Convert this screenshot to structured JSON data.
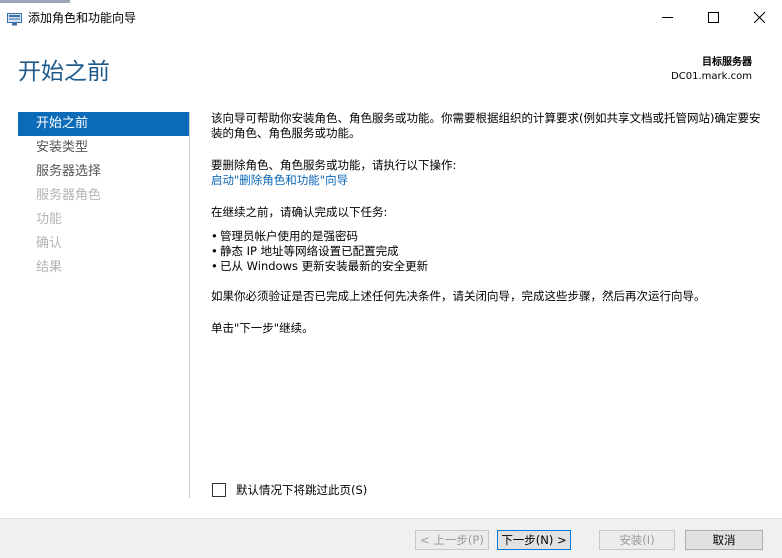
{
  "window": {
    "title": "添加角色和功能向导"
  },
  "header": {
    "page_title": "开始之前",
    "target_label": "目标服务器",
    "target_value": "DC01.mark.com"
  },
  "nav": {
    "items": [
      {
        "label": "开始之前",
        "state": "active"
      },
      {
        "label": "安装类型",
        "state": "normal"
      },
      {
        "label": "服务器选择",
        "state": "normal"
      },
      {
        "label": "服务器角色",
        "state": "disabled"
      },
      {
        "label": "功能",
        "state": "disabled"
      },
      {
        "label": "确认",
        "state": "disabled"
      },
      {
        "label": "结果",
        "state": "disabled"
      }
    ]
  },
  "content": {
    "intro": "该向导可帮助你安装角色、角色服务或功能。你需要根据组织的计算要求(例如共享文档或托管网站)确定要安装的角色、角色服务或功能。",
    "remove_text": "要删除角色、角色服务或功能，请执行以下操作:",
    "remove_link": "启动\"删除角色和功能\"向导",
    "before_text": "在继续之前，请确认完成以下任务:",
    "tasks": [
      "管理员帐户使用的是强密码",
      "静态 IP 地址等网络设置已配置完成",
      "已从 Windows 更新安装最新的安全更新"
    ],
    "verify_text": "如果你必须验证是否已完成上述任何先决条件，请关闭向导，完成这些步骤，然后再次运行向导。",
    "click_next_text": "单击\"下一步\"继续。"
  },
  "skip_checkbox": {
    "label": "默认情况下将跳过此页(S)",
    "checked": false
  },
  "footer": {
    "prev_label": "< 上一步(P)",
    "next_label": "下一步(N) >",
    "install_label": "安装(I)",
    "cancel_label": "取消"
  },
  "colors": {
    "accent": "#0c6bb8",
    "title": "#1e5b8c",
    "link": "#0a66b7"
  }
}
